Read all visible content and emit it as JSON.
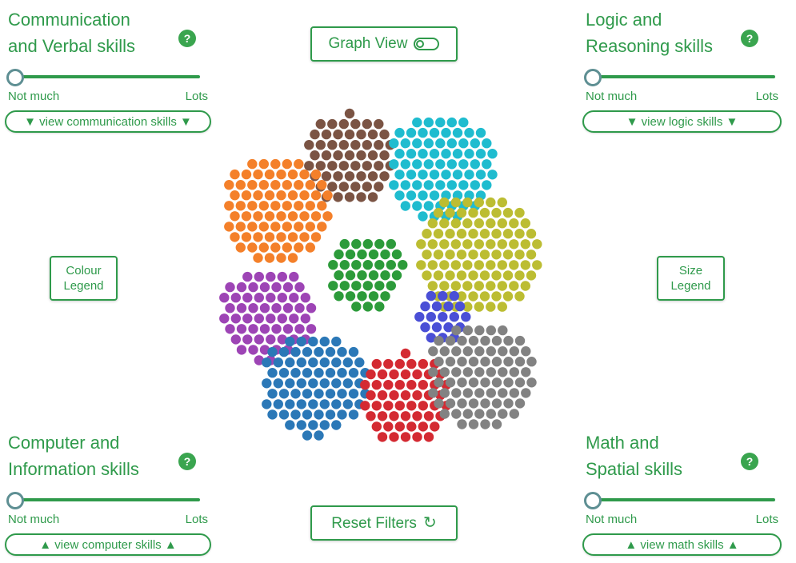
{
  "graph_view": {
    "label": "Graph View",
    "toggle_icon": "toggle-icon"
  },
  "reset": {
    "label": "Reset Filters",
    "icon": "reset-icon"
  },
  "legends": {
    "colour": "Colour Legend",
    "size": "Size Legend"
  },
  "panels": {
    "communication": {
      "title_line1": "Communication",
      "title_line2": "and Verbal skills",
      "help": "?",
      "low": "Not much",
      "high": "Lots",
      "level": 0,
      "view": "▼ view communication skills ▼"
    },
    "logic": {
      "title_line1": "Logic and",
      "title_line2": "Reasoning skills",
      "help": "?",
      "low": "Not much",
      "high": "Lots",
      "level": 0,
      "view": "▼ view logic skills ▼"
    },
    "computer": {
      "title_line1": "Computer and",
      "title_line2": "Information skills",
      "help": "?",
      "low": "Not much",
      "high": "Lots",
      "level": 0,
      "view": "▲ view computer skills ▲"
    },
    "math": {
      "title_line1": "Math and",
      "title_line2": "Spatial skills",
      "help": "?",
      "low": "Not much",
      "high": "Lots",
      "level": 0,
      "view": "▲ view math skills ▲"
    }
  },
  "colors": {
    "accent": "#2f9a4b",
    "clusters": [
      "#7b5444",
      "#1fbccf",
      "#f4802a",
      "#bcbd32",
      "#2c9b3a",
      "#9d44b5",
      "#4a4fd6",
      "#2b78b7",
      "#d42a32",
      "#828282"
    ]
  }
}
